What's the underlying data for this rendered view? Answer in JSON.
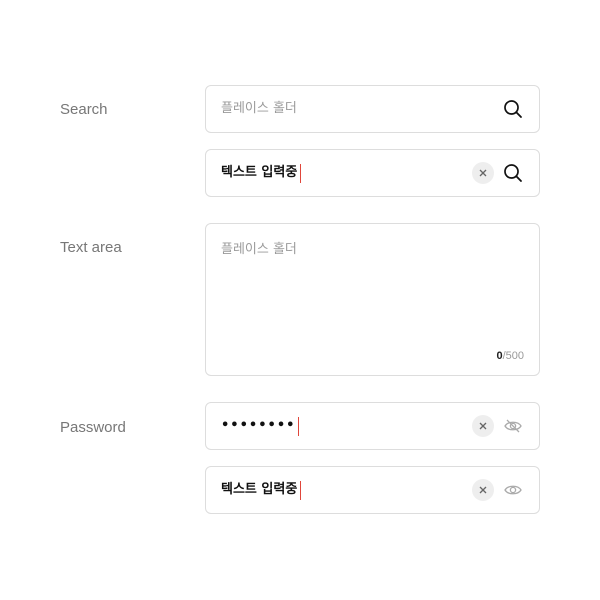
{
  "search": {
    "label": "Search",
    "empty_field": {
      "placeholder": "플레이스 홀더"
    },
    "typing_field": {
      "value": "텍스트 입력중"
    }
  },
  "textarea": {
    "label": "Text area",
    "placeholder": "플레이스 홀더",
    "counter_current": "0",
    "counter_max": "/500"
  },
  "password": {
    "label": "Password",
    "masked_field": {
      "value": "••••••••"
    },
    "visible_field": {
      "value": "텍스트 입력중"
    }
  },
  "colors": {
    "caret": "#e0463b",
    "border": "#dddddd",
    "clear_button_bg": "#eeeeee"
  },
  "icons": {
    "search": "search-icon",
    "clear": "close-icon",
    "hidden": "eye-off-icon",
    "visible": "eye-icon"
  }
}
